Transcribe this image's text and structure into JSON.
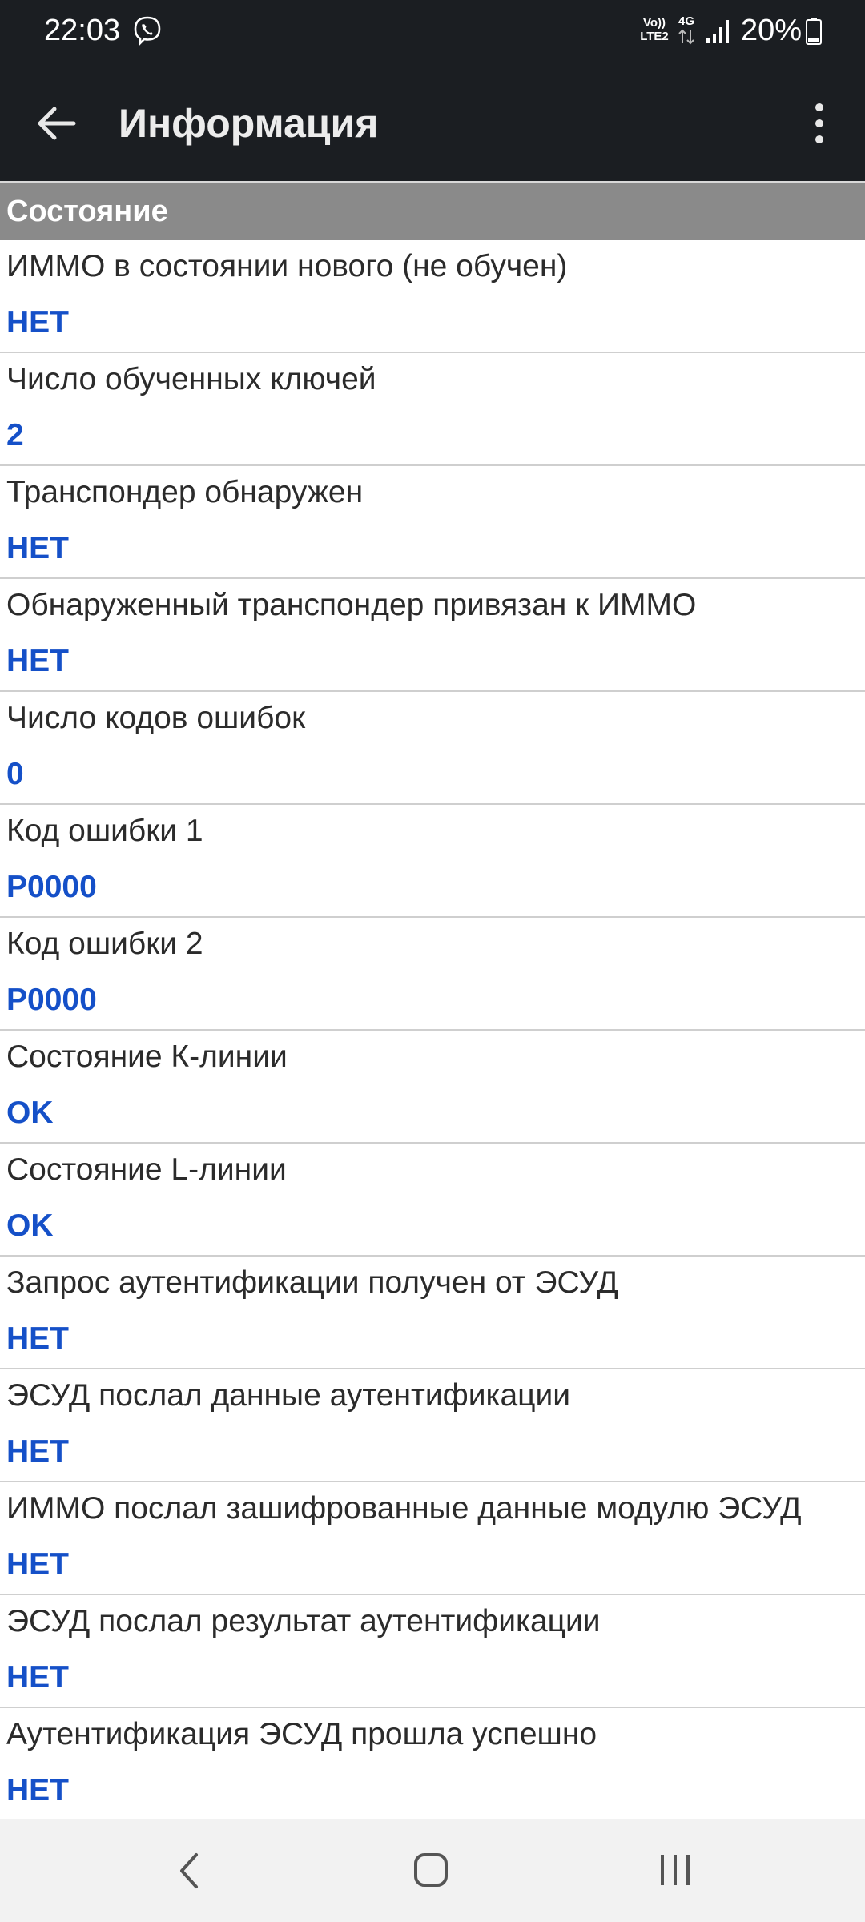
{
  "status_bar": {
    "time": "22:03",
    "network_top": "Vo))",
    "network_bottom": "LTE2",
    "network_type": "4G",
    "battery": "20%",
    "icons": [
      "viber-icon",
      "signal-icon",
      "battery-icon"
    ]
  },
  "app_bar": {
    "title": "Информация",
    "back_icon": "arrow-left-icon",
    "menu_icon": "more-vert-icon"
  },
  "section": {
    "title": "Состояние"
  },
  "rows": [
    {
      "label": "ИММО в состоянии нового (не обучен)",
      "value": "НЕТ"
    },
    {
      "label": "Число обученных ключей",
      "value": "2"
    },
    {
      "label": "Транспондер обнаружен",
      "value": "НЕТ"
    },
    {
      "label": "Обнаруженный транспондер привязан к ИММО",
      "value": "НЕТ"
    },
    {
      "label": "Число кодов ошибок",
      "value": "0"
    },
    {
      "label": "Код ошибки 1",
      "value": "P0000"
    },
    {
      "label": "Код ошибки 2",
      "value": "P0000"
    },
    {
      "label": "Состояние К-линии",
      "value": "OK"
    },
    {
      "label": "Состояние L-линии",
      "value": "OK"
    },
    {
      "label": "Запрос аутентификации получен от ЭСУД",
      "value": "НЕТ"
    },
    {
      "label": "ЭСУД послал данные аутентификации",
      "value": "НЕТ"
    },
    {
      "label": "ИММО послал зашифрованные данные модулю ЭСУД",
      "value": "НЕТ"
    },
    {
      "label": "ЭСУД послал результат аутентификации",
      "value": "НЕТ"
    },
    {
      "label": "Аутентификация ЭСУД прошла успешно",
      "value": "НЕТ"
    }
  ],
  "nav_bar": {
    "icons": [
      "nav-back-icon",
      "nav-home-icon",
      "nav-recents-icon"
    ]
  },
  "colors": {
    "bar_background": "#1b1e22",
    "section_header": "#8a8a8a",
    "value_text": "#1550c8",
    "divider": "#cfcfcf"
  }
}
